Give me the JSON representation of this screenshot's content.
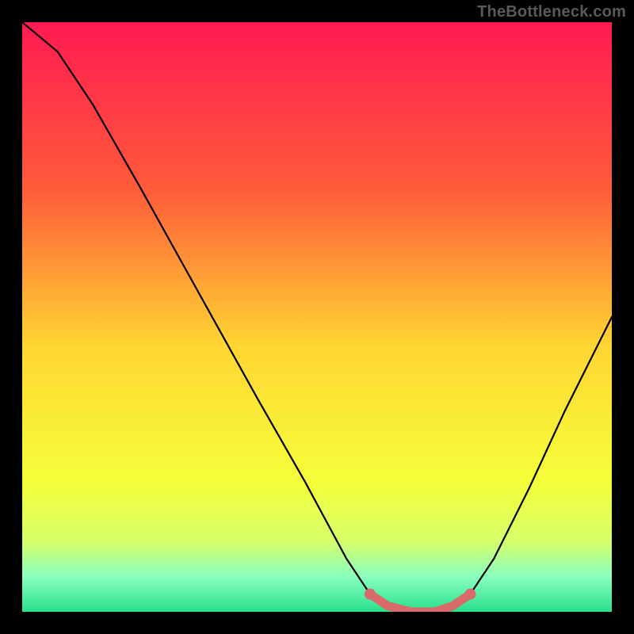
{
  "attribution": "TheBottleneck.com",
  "chart_data": {
    "type": "line",
    "title": "",
    "xlabel": "",
    "ylabel": "",
    "xlim": [
      0,
      100
    ],
    "ylim": [
      0,
      100
    ],
    "gradient_stops": [
      {
        "offset": 0,
        "color": "#ff1a52"
      },
      {
        "offset": 28,
        "color": "#ff5a3a"
      },
      {
        "offset": 55,
        "color": "#ffd632"
      },
      {
        "offset": 78,
        "color": "#f5ff3a"
      },
      {
        "offset": 88,
        "color": "#d6ff6a"
      },
      {
        "offset": 94,
        "color": "#8affc0"
      },
      {
        "offset": 100,
        "color": "#28e08c"
      }
    ],
    "series": [
      {
        "name": "bottleneck-curve",
        "color": "#000000",
        "type": "line",
        "points": [
          {
            "x": 0,
            "y": 100
          },
          {
            "x": 6,
            "y": 95
          },
          {
            "x": 12,
            "y": 86
          },
          {
            "x": 20,
            "y": 72
          },
          {
            "x": 30,
            "y": 54
          },
          {
            "x": 40,
            "y": 36
          },
          {
            "x": 48,
            "y": 22
          },
          {
            "x": 55,
            "y": 9
          },
          {
            "x": 59,
            "y": 3
          },
          {
            "x": 62,
            "y": 1
          },
          {
            "x": 66,
            "y": 0
          },
          {
            "x": 70,
            "y": 0
          },
          {
            "x": 73,
            "y": 1
          },
          {
            "x": 76,
            "y": 3
          },
          {
            "x": 80,
            "y": 9
          },
          {
            "x": 86,
            "y": 21
          },
          {
            "x": 92,
            "y": 34
          },
          {
            "x": 100,
            "y": 50
          }
        ]
      },
      {
        "name": "optimal-range-highlight",
        "color": "#d96a6a",
        "type": "line",
        "thick": true,
        "points": [
          {
            "x": 59,
            "y": 3
          },
          {
            "x": 62,
            "y": 1
          },
          {
            "x": 66,
            "y": 0
          },
          {
            "x": 70,
            "y": 0
          },
          {
            "x": 73,
            "y": 1
          },
          {
            "x": 76,
            "y": 3
          }
        ]
      }
    ],
    "optimal_range": {
      "start_x": 59,
      "end_x": 76
    },
    "curve_minimum": {
      "x": 68,
      "y": 0
    }
  }
}
